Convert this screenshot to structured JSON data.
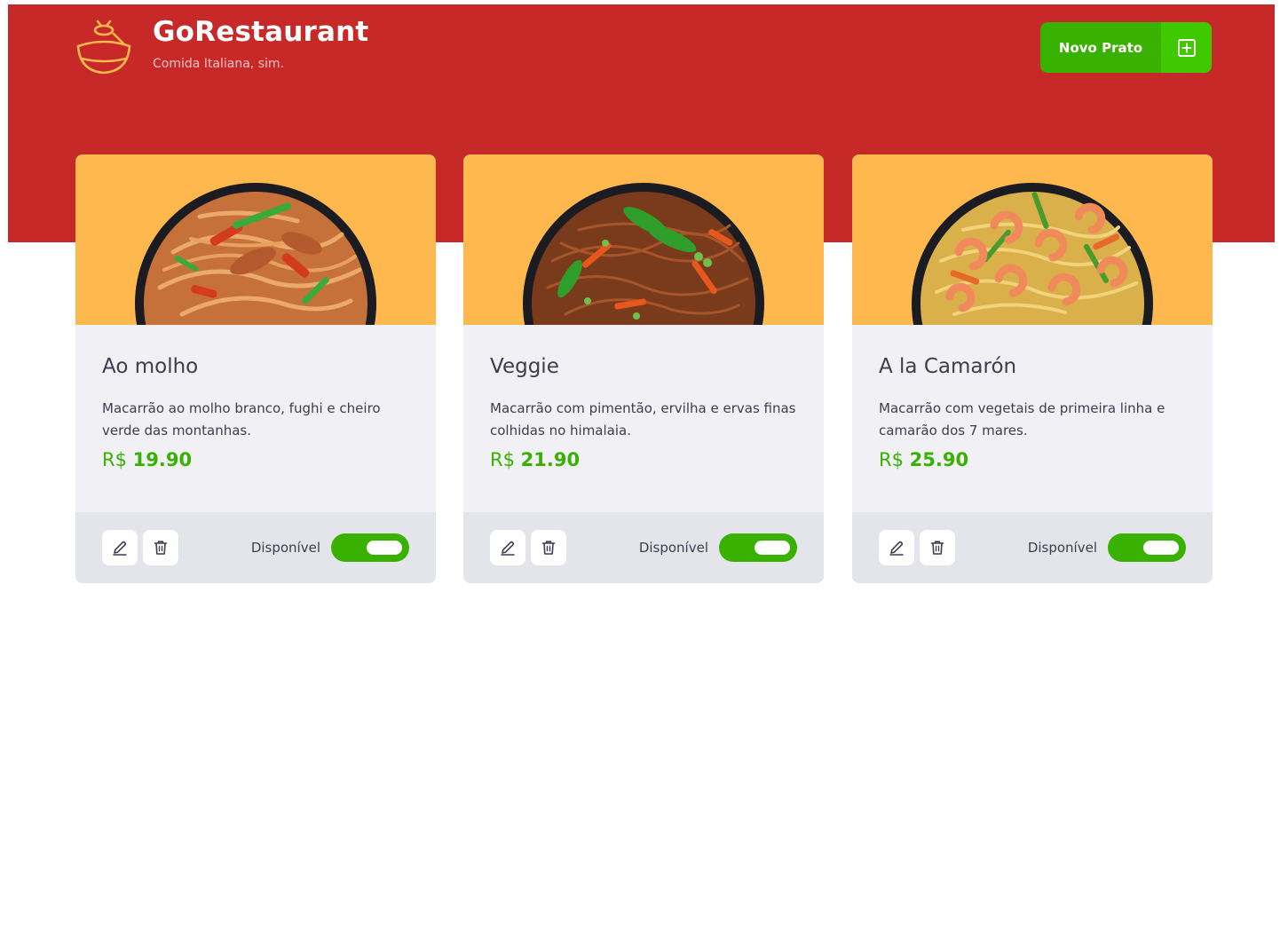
{
  "header": {
    "title": "GoRestaurant",
    "subtitle": "Comida Italiana, sim.",
    "logo_icon": "bowl-icon",
    "new_dish_label": "Novo Prato",
    "new_dish_icon": "plus-square-icon"
  },
  "colors": {
    "header_bg": "#c72828",
    "card_image_bg": "#ffb84d",
    "accent_green": "#39b100",
    "card_bg": "#f0f0f5",
    "card_footer_bg": "#e4e4eb"
  },
  "dishes": [
    {
      "name": "Ao molho",
      "description": "Macarrão ao molho branco, fughi e cheiro verde das montanhas.",
      "currency": "R$",
      "price": "19.90",
      "availability_label": "Disponível",
      "available": true
    },
    {
      "name": "Veggie",
      "description": "Macarrão com pimentão, ervilha e ervas finas colhidas no himalaia.",
      "currency": "R$",
      "price": "21.90",
      "availability_label": "Disponível",
      "available": true
    },
    {
      "name": "A la Camarón",
      "description": "Macarrão com vegetais de primeira linha e camarão dos 7 mares.",
      "currency": "R$",
      "price": "25.90",
      "availability_label": "Disponível",
      "available": true
    }
  ]
}
